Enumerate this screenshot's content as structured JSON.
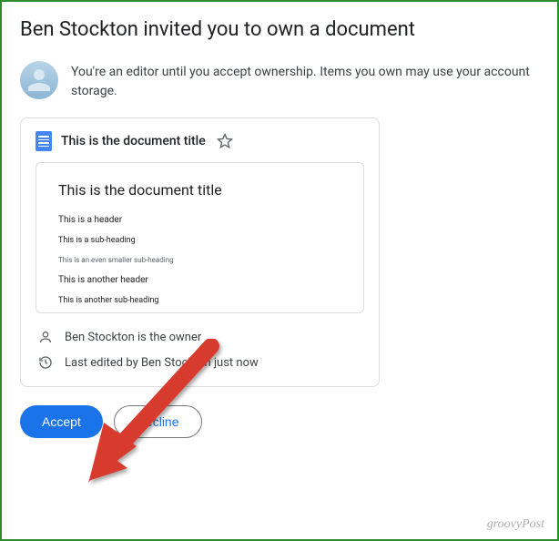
{
  "title": "Ben Stockton invited you to own a document",
  "info": "You're an editor until you accept ownership. Items you own may use your account storage.",
  "doc": {
    "title": "This is the document title",
    "preview": {
      "title": "This is the document title",
      "lines": [
        "This is a header",
        "This is a sub-heading",
        "This is an even smaller sub-heading",
        "This is another header",
        "This is another sub-heading"
      ]
    },
    "owner": "Ben Stockton is the owner",
    "last_edited": "Last edited by Ben Stockton just now"
  },
  "buttons": {
    "accept": "Accept",
    "decline": "Decline"
  },
  "watermark": "groovyPost"
}
